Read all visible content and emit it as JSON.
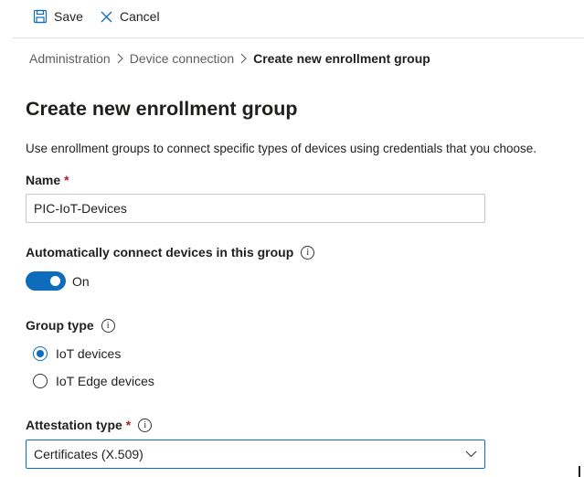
{
  "toolbar": {
    "save_label": "Save",
    "cancel_label": "Cancel"
  },
  "breadcrumb": {
    "items": [
      "Administration",
      "Device connection"
    ],
    "current": "Create new enrollment group"
  },
  "page": {
    "title": "Create new enrollment group",
    "description": "Use enrollment groups to connect specific types of devices using credentials that you choose."
  },
  "name_field": {
    "label": "Name",
    "required_mark": "*",
    "value": "PIC-IoT-Devices"
  },
  "auto_connect": {
    "label": "Automatically connect devices in this group",
    "info_icon": "info-icon",
    "toggle_state": "On",
    "enabled": true
  },
  "group_type": {
    "label": "Group type",
    "options": [
      "IoT devices",
      "IoT Edge devices"
    ],
    "selected": "IoT devices"
  },
  "attestation": {
    "label": "Attestation type",
    "required_mark": "*",
    "value": "Certificates (X.509)"
  },
  "colors": {
    "accent": "#0f6cbd",
    "required": "#a4262c",
    "border": "#c8c6c4"
  }
}
